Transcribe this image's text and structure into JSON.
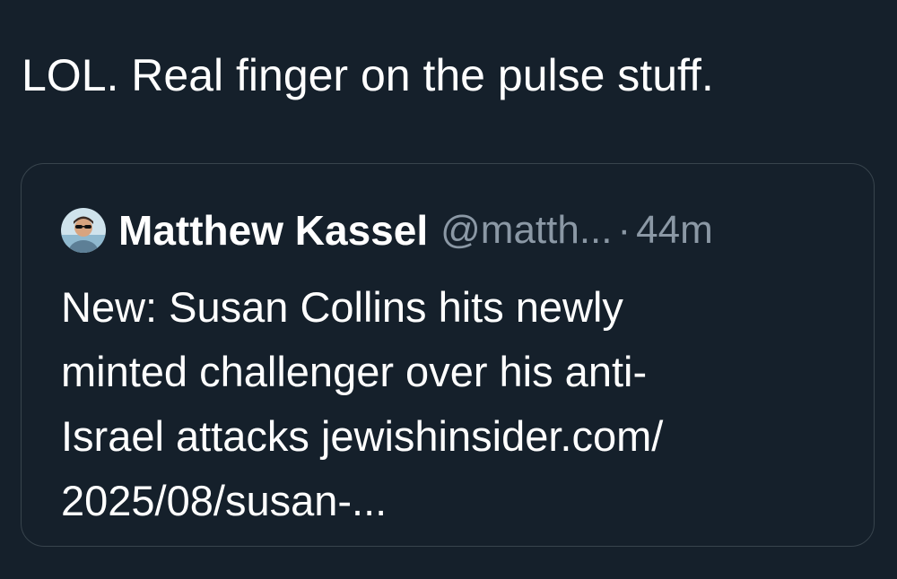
{
  "tweet": {
    "text": "LOL. Real finger on the pulse stuff."
  },
  "quoted_tweet": {
    "author_name": "Matthew Kassel",
    "author_handle": "@matth...",
    "separator": "·",
    "timestamp": "44m",
    "avatar_icon": "profile-photo-avatar",
    "text_lines": [
      "New: Susan Collins hits newly",
      "minted challenger over his anti-",
      "Israel attacks jewishinsider.com/",
      "2025/08/susan-..."
    ]
  },
  "colors": {
    "background": "#15202b",
    "text_primary": "#ffffff",
    "text_secondary": "#8b98a5",
    "border": "#38444d"
  }
}
